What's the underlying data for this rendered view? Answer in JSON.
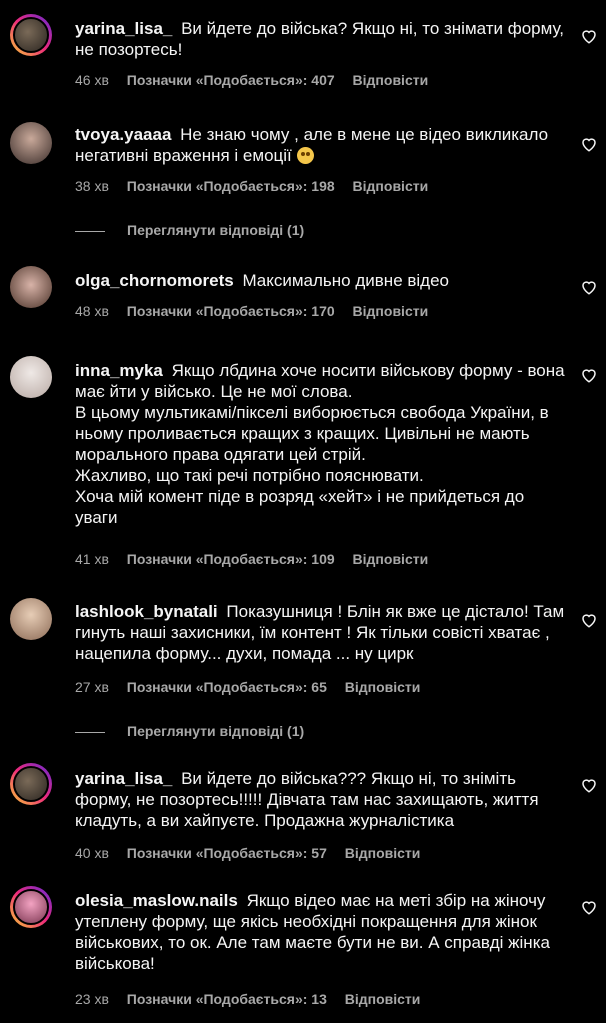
{
  "comments": [
    {
      "username": "yarina_lisa_",
      "text": "Ви йдете до війська? Якщо ні, то знімати форму, не позортесь!",
      "time": "46 хв",
      "likes": "Позначки «Подобається»: 407",
      "reply": "Відповісти"
    },
    {
      "username": "tvoya.yaaaa",
      "text": "Не знаю чому , але в мене це відео викликало негативні враження і емоції",
      "time": "38 хв",
      "likes": "Позначки «Подобається»: 198",
      "reply": "Відповісти",
      "view_replies": "Переглянути відповіді (1)"
    },
    {
      "username": "olga_chornomorets",
      "text": "Максимально дивне відео",
      "time": "48 хв",
      "likes": "Позначки «Подобається»: 170",
      "reply": "Відповісти"
    },
    {
      "username": "inna_myka",
      "text": "Якщо лбдина хоче носити військову форму - вона має йти у військо. Це не мої слова.",
      "text_lines": [
        "В цьому мультикамі/пікселі виборюється свобода України, в ньому проливається кращих з кращих. Цивільні не мають морального права одягати цей стрій.",
        "Жахливо, що такі речі потрібно пояснювати.",
        "Хоча мій комент піде в розряд «хейт» і не прийдеться до уваги"
      ],
      "time": "41 хв",
      "likes": "Позначки «Подобається»: 109",
      "reply": "Відповісти"
    },
    {
      "username": "lashlook_bynatali",
      "text": "Показушниця ! Блін як вже це дістало! Там гинуть наші захисники, їм контент ! Як тільки совісті хватає , нацепила форму... духи, помада ... ну цирк",
      "time": "27 хв",
      "likes": "Позначки «Подобається»: 65",
      "reply": "Відповісти",
      "view_replies": "Переглянути відповіді (1)"
    },
    {
      "username": "yarina_lisa_",
      "text": "Ви йдете до війська??? Якщо ні, то зніміть форму, не позортесь!!!!! Дівчата там нас захищають, життя кладуть, а ви хайпуєте. Продажна журналістика",
      "time": "40 хв",
      "likes": "Позначки «Подобається»: 57",
      "reply": "Відповісти"
    },
    {
      "username": "olesia_maslow.nails",
      "text": "Якщо відео має на меті збір на жіночу утеплену форму, ще якісь необхідні покращення для жінок військових, то ок. Але там маєте бути не ви. А справді жінка військова!",
      "time": "23 хв",
      "likes": "Позначки «Подобається»: 13",
      "reply": "Відповісти"
    }
  ],
  "colors": {
    "background": "#000000",
    "text": "#f5f5f5",
    "muted": "#a8a8a8"
  }
}
